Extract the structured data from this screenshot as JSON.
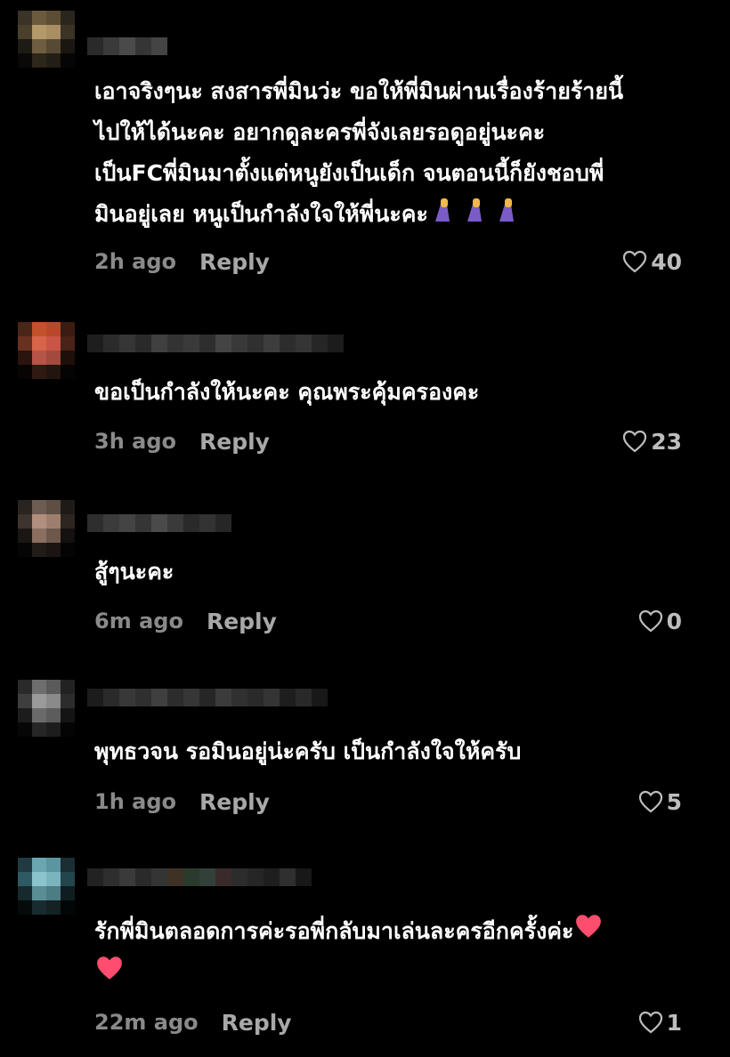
{
  "comments": [
    {
      "text": "เอาจริงๆนะ สงสารพี่มินว่ะ ขอให้พี่มินผ่านเรื่องร้ายร้ายนี้\nไปให้ได้นะคะ อยากดูละครพี่จังเลยรอดูอยู่นะคะ\nเป็นFCพี่มินมาตั้งแต่หนูยังเป็นเด็ก จนตอนนี้ก็ยังชอบพี่\nมินอยู่เลย หนูเป็นกำลังใจให้พี่นะคะ",
      "emojis": [
        "🙏",
        "🙏",
        "🙏"
      ],
      "time": "2h ago",
      "reply": "Reply",
      "likes": "40"
    },
    {
      "text": "ขอเป็นกำลังให้นะคะ คุณพระคุ้มครองคะ",
      "emojis": [],
      "time": "3h ago",
      "reply": "Reply",
      "likes": "23"
    },
    {
      "text": "สู้ๆนะคะ",
      "emojis": [],
      "time": "6m ago",
      "reply": "Reply",
      "likes": "0"
    },
    {
      "text": "พุทธวจน รอมินอยู่น่ะครับ เป็นกำลังใจให้ครับ",
      "emojis": [],
      "time": "1h ago",
      "reply": "Reply",
      "likes": "5"
    },
    {
      "text": "รักพี่มินตลอดการค่ะรอพี่กลับมาเล่นละครอีกครั้งค่ะ",
      "emojis": [
        "❤️",
        "❤️"
      ],
      "time": "22m ago",
      "reply": "Reply",
      "likes": "1"
    }
  ],
  "colors": {
    "background": "#000000",
    "text": "#ffffff",
    "meta": "#8a8a8a",
    "heart_emoji": "#ff4d6d",
    "pray_emoji": "#7b5bc8"
  },
  "icons": {
    "like": "heart-outline-icon",
    "avatar": "pixelated-avatar"
  }
}
